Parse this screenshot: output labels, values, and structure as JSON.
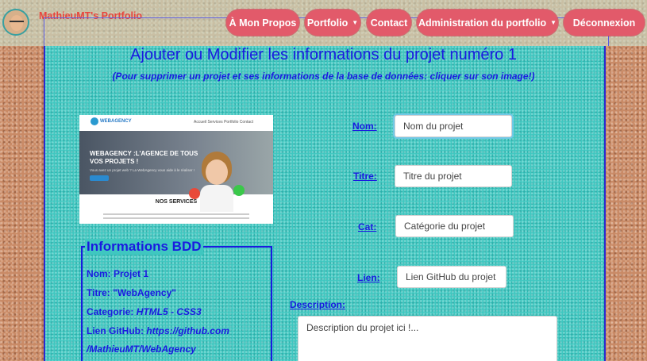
{
  "navbar": {
    "brand": "MathieuMT's Portfolio",
    "items": [
      {
        "label": "À Mon Propos"
      },
      {
        "label": "Portfolio",
        "caret": "▼"
      },
      {
        "label": "Contact"
      },
      {
        "label": "Administration du portfolio",
        "caret": "▼"
      },
      {
        "label": "Déconnexion"
      }
    ]
  },
  "page": {
    "title": "Ajouter ou Modifier les informations du projet numéro 1",
    "subtitle": "(Pour supprimer un projet et ses informations de la base de données: cliquer sur son image!)"
  },
  "project_image": {
    "logo": "WEBAGENCY",
    "menu": "Accueil  Services  Portfolio  Contact",
    "hero_title": "WEBAGENCY :L'AGENCE DE TOUS VOS PROJETS !",
    "hero_text": "Vous avez un projet web ? La WebAgency vous aide à le réaliser !",
    "section": "NOS SERVICES"
  },
  "info": {
    "title": "Informations BDD",
    "nom_label": "Nom: ",
    "nom_value": "Projet 1",
    "titre_label": "Titre: ",
    "titre_value": "\"WebAgency\"",
    "categorie_label": "Categorie: ",
    "categorie_value": "HTML5 - CSS3",
    "lien_label": "Lien GitHub: ",
    "lien_value": "https://github.com",
    "lien_value_2": "/MathieuMT/WebAgency"
  },
  "form": {
    "nom_label": "Nom:",
    "nom_placeholder": "Nom du projet",
    "titre_label": "Titre:",
    "titre_placeholder": "Titre du projet",
    "cat_label": "Cat:",
    "cat_placeholder": "Catégorie du projet",
    "lien_label": "Lien:",
    "lien_placeholder": "Lien GitHub du projet",
    "description_label": "Description:",
    "description_placeholder": "Description du projet ici !..."
  }
}
